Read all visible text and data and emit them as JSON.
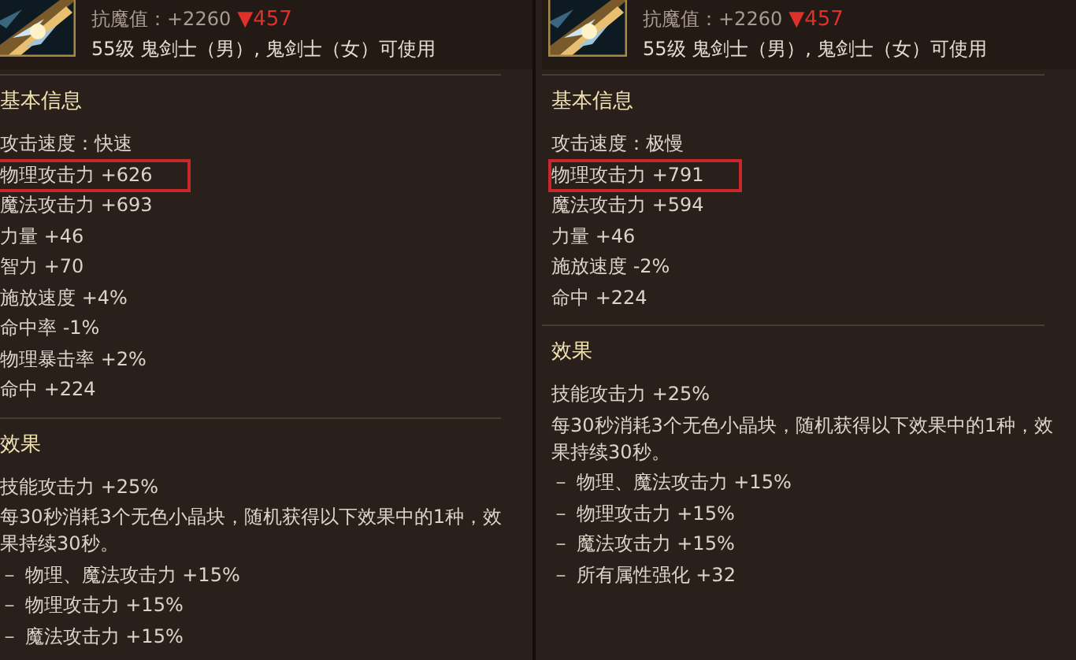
{
  "panels": [
    {
      "header": {
        "stat": "抗魔值：+2260",
        "change": "▼457",
        "requirement": "55级 鬼剑士（男）, 鬼剑士（女）可使用"
      },
      "sections": [
        {
          "title": "基本信息",
          "lines": [
            {
              "text": "攻击速度：快速",
              "highlighted": false
            },
            {
              "text": "物理攻击力 +626",
              "highlighted": true
            },
            {
              "text": "魔法攻击力 +693",
              "highlighted": false
            },
            {
              "text": "力量 +46",
              "highlighted": false
            },
            {
              "text": "智力 +70",
              "highlighted": false
            },
            {
              "text": "施放速度 +4%",
              "highlighted": false
            },
            {
              "text": "命中率 -1%",
              "highlighted": false
            },
            {
              "text": "物理暴击率 +2%",
              "highlighted": false
            },
            {
              "text": "命中 +224",
              "highlighted": false
            }
          ]
        },
        {
          "title": "效果",
          "lines": [
            {
              "text": "技能攻击力 +25%",
              "highlighted": false
            },
            {
              "text": "每30秒消耗3个无色小晶块，随机获得以下效果中的1种，效果持续30秒。",
              "highlighted": false
            },
            {
              "text": "－ 物理、魔法攻击力 +15%",
              "highlighted": false
            },
            {
              "text": "－ 物理攻击力 +15%",
              "highlighted": false
            },
            {
              "text": "－ 魔法攻击力 +15%",
              "highlighted": false
            }
          ]
        }
      ]
    },
    {
      "header": {
        "stat": "抗魔值：+2260",
        "change": "▼457",
        "requirement": "55级 鬼剑士（男）, 鬼剑士（女）可使用"
      },
      "sections": [
        {
          "title": "基本信息",
          "lines": [
            {
              "text": "攻击速度：极慢",
              "highlighted": false
            },
            {
              "text": "物理攻击力 +791",
              "highlighted": true
            },
            {
              "text": "魔法攻击力 +594",
              "highlighted": false
            },
            {
              "text": "力量 +46",
              "highlighted": false
            },
            {
              "text": "施放速度 -2%",
              "highlighted": false
            },
            {
              "text": "命中 +224",
              "highlighted": false
            }
          ]
        },
        {
          "title": "效果",
          "lines": [
            {
              "text": "技能攻击力 +25%",
              "highlighted": false
            },
            {
              "text": "每30秒消耗3个无色小晶块，随机获得以下效果中的1种，效果持续30秒。",
              "highlighted": false
            },
            {
              "text": "－ 物理、魔法攻击力 +15%",
              "highlighted": false
            },
            {
              "text": "－ 物理攻击力 +15%",
              "highlighted": false
            },
            {
              "text": "－ 魔法攻击力 +15%",
              "highlighted": false
            },
            {
              "text": "－ 所有属性强化 +32",
              "highlighted": false
            }
          ]
        }
      ]
    }
  ]
}
